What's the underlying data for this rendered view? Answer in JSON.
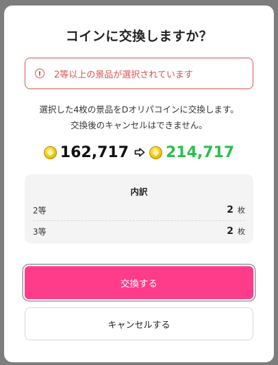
{
  "dialog": {
    "title": "コインに交換しますか？",
    "warning": "2等以上の景品が選択されています",
    "description_line1": "選択した4枚の景品をDオリパコインに交換します。",
    "description_line2": "交換後のキャンセルはできません。",
    "coins_before": "162,717",
    "coins_after": "214,717",
    "breakdown": {
      "title": "内訳",
      "rows": [
        {
          "label": "2等",
          "count": "2",
          "unit": "枚"
        },
        {
          "label": "3等",
          "count": "2",
          "unit": "枚"
        }
      ]
    },
    "confirm_label": "交換する",
    "cancel_label": "キャンセルする"
  },
  "icons": {
    "warning": "alert-circle-icon",
    "coin": "coin-icon",
    "arrow": "arrow-right-icon"
  },
  "colors": {
    "warning": "#d9534f",
    "coins_after": "#2bbf4f",
    "confirm_button": "#ff3c8a",
    "overlay": "#7d7d7d"
  }
}
